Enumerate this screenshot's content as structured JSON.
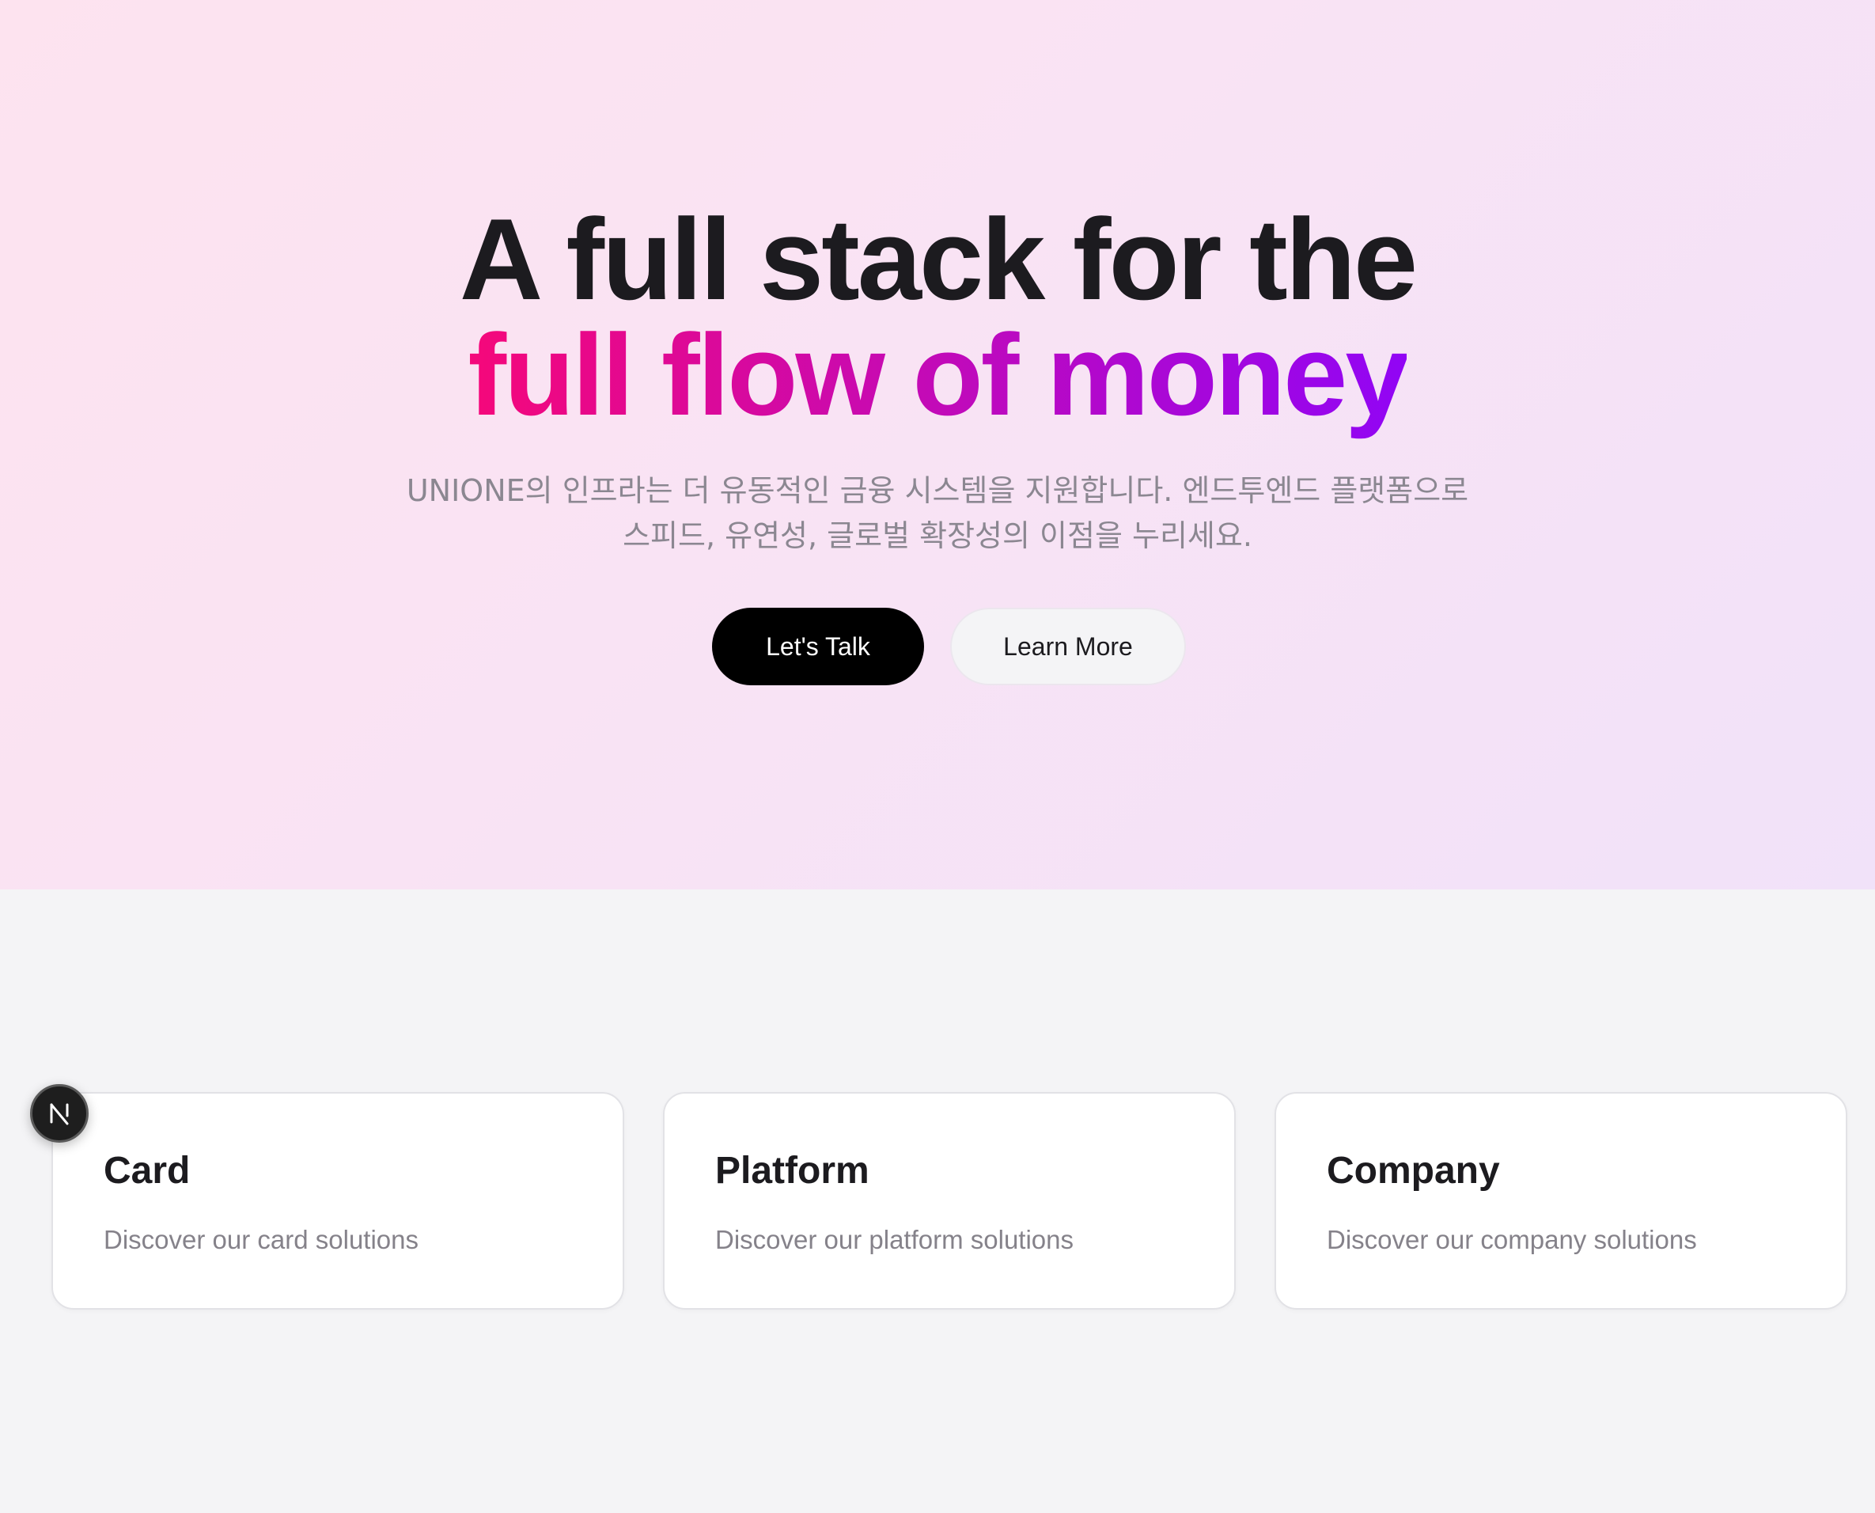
{
  "hero": {
    "headline_line1": "A full stack for the",
    "headline_line2": "full flow of money",
    "subtitle_line1": "UNIONE의 인프라는 더 유동적인 금융 시스템을 지원합니다. 엔드투엔드 플랫폼으로",
    "subtitle_line2": "스피드, 유연성, 글로벌 확장성의 이점을 누리세요.",
    "primary_button": "Let's Talk",
    "secondary_button": "Learn More"
  },
  "cards": [
    {
      "title": "Card",
      "description": "Discover our card solutions"
    },
    {
      "title": "Platform",
      "description": "Discover our platform solutions"
    },
    {
      "title": "Company",
      "description": "Discover our company solutions"
    }
  ],
  "badge": {
    "icon": "nextjs-n-icon"
  },
  "colors": {
    "headline": "#1c1b1f",
    "gradient_start": "#f5087a",
    "gradient_end": "#9105f5",
    "primary_button_bg": "#000000",
    "secondary_button_bg": "#f4f4f6",
    "page_bg": "#f4f4f6"
  }
}
